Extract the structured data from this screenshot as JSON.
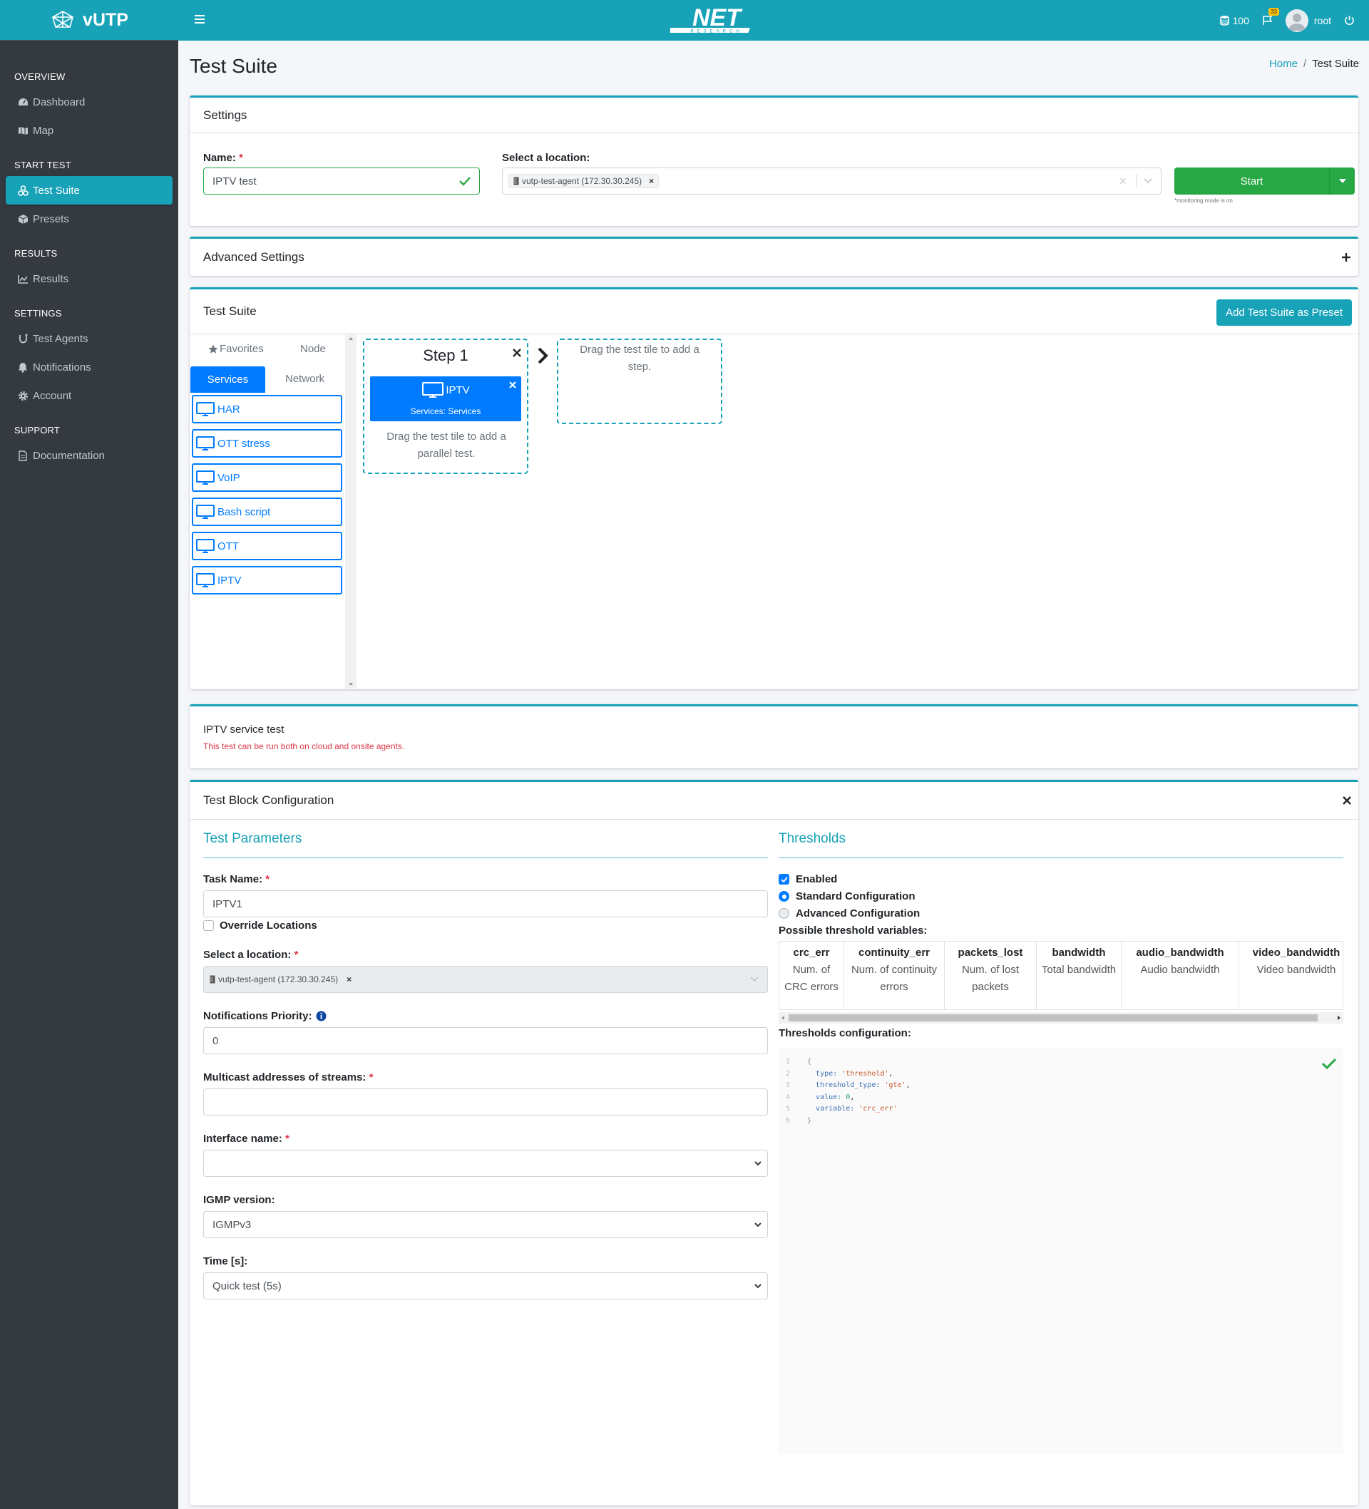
{
  "app": {
    "brand": "vUTP",
    "logo_text": "NET",
    "logo_sub": "RESEARCH"
  },
  "topbar": {
    "credits": "100",
    "notif_badge": "33",
    "user": "root"
  },
  "sidebar": {
    "sections": [
      {
        "header": "OVERVIEW",
        "items": [
          {
            "label": "Dashboard",
            "icon": "dashboard-icon"
          },
          {
            "label": "Map",
            "icon": "map-icon"
          }
        ]
      },
      {
        "header": "START TEST",
        "items": [
          {
            "label": "Test Suite",
            "icon": "test-suite-icon",
            "active": true
          },
          {
            "label": "Presets",
            "icon": "cube-icon"
          }
        ]
      },
      {
        "header": "RESULTS",
        "items": [
          {
            "label": "Results",
            "icon": "chart-line-icon"
          }
        ]
      },
      {
        "header": "SETTINGS",
        "items": [
          {
            "label": "Test Agents",
            "icon": "agent-icon"
          },
          {
            "label": "Notifications",
            "icon": "bell-icon"
          },
          {
            "label": "Account",
            "icon": "gear-icon"
          }
        ]
      },
      {
        "header": "SUPPORT",
        "items": [
          {
            "label": "Documentation",
            "icon": "document-icon"
          }
        ]
      }
    ]
  },
  "page": {
    "title": "Test Suite",
    "breadcrumb_home": "Home",
    "breadcrumb_current": "Test Suite"
  },
  "settings": {
    "title": "Settings",
    "name_label": "Name:",
    "name_value": "IPTV test",
    "location_label": "Select a location:",
    "location_chip": "vutp-test-agent (172.30.30.245)",
    "start_label": "Start",
    "monitoring_note": "*monitoring mode is on"
  },
  "advanced": {
    "title": "Advanced Settings"
  },
  "suite": {
    "title": "Test Suite",
    "add_preset": "Add Test Suite as Preset",
    "tabs": {
      "favorites": "Favorites",
      "node": "Node",
      "services": "Services",
      "network": "Network"
    },
    "tiles": [
      "HAR",
      "OTT stress",
      "VoIP",
      "Bash script",
      "OTT",
      "IPTV"
    ],
    "step1": {
      "title": "Step 1",
      "tile_title": "IPTV",
      "tile_sub": "Services: Services",
      "parallel_hint": "Drag the test tile to add a parallel test."
    },
    "next_step_hint": "Drag the test tile to add a step."
  },
  "info": {
    "title": "IPTV service test",
    "note": "This test can be run both on cloud and onsite agents."
  },
  "config": {
    "title": "Test Block Configuration",
    "params_title": "Test Parameters",
    "task_name_label": "Task Name:",
    "task_name_value": "IPTV1",
    "override_label": "Override Locations",
    "location_label": "Select a location:",
    "location_chip": "vutp-test-agent (172.30.30.245)",
    "priority_label": "Notifications Priority:",
    "priority_value": "0",
    "multicast_label": "Multicast addresses of streams:",
    "multicast_value": "",
    "interface_label": "Interface name:",
    "interface_value": "",
    "igmp_label": "IGMP version:",
    "igmp_value": "IGMPv3",
    "time_label": "Time [s]:",
    "time_value": "Quick test (5s)"
  },
  "thresholds": {
    "title": "Thresholds",
    "enabled_label": "Enabled",
    "standard_label": "Standard Configuration",
    "advanced_label": "Advanced Configuration",
    "vars_label": "Possible threshold variables:",
    "variables": [
      {
        "name": "crc_err",
        "desc": "Num. of CRC errors"
      },
      {
        "name": "continuity_err",
        "desc": "Num. of continuity errors"
      },
      {
        "name": "packets_lost",
        "desc": "Num. of lost packets"
      },
      {
        "name": "bandwidth",
        "desc": "Total bandwidth"
      },
      {
        "name": "audio_bandwidth",
        "desc": "Audio bandwidth"
      },
      {
        "name": "video_bandwidth",
        "desc": "Video bandwidth"
      }
    ],
    "config_label": "Thresholds configuration:",
    "code": {
      "l1": "{",
      "k_type": "type:",
      "v_type": "'threshold'",
      "k_ttype": "threshold_type:",
      "v_ttype": "'gte'",
      "k_value": "value:",
      "v_value": "0",
      "k_var": "variable:",
      "v_var": "'crc_err'",
      "l6": "}"
    }
  }
}
